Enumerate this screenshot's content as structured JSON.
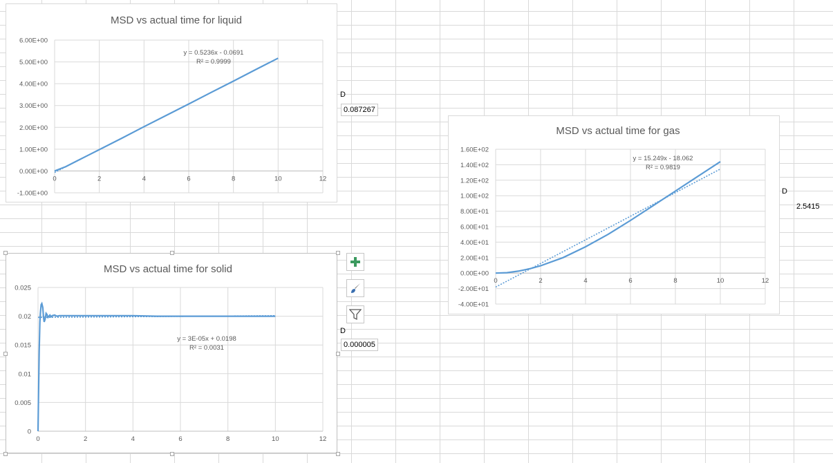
{
  "chart_data": [
    {
      "id": "liquid",
      "type": "line",
      "title": "MSD vs actual time for liquid",
      "xlabel": "",
      "ylabel": "",
      "xlim": [
        0,
        12
      ],
      "ylim": [
        -1,
        6
      ],
      "x_ticks": [
        0,
        2,
        4,
        6,
        8,
        10,
        12
      ],
      "x_tick_labels": [
        "0",
        "2",
        "4",
        "6",
        "8",
        "10",
        "12"
      ],
      "y_ticks": [
        -1,
        0,
        1,
        2,
        3,
        4,
        5,
        6
      ],
      "y_tick_labels": [
        "-1.00E+00",
        "0.00E+00",
        "1.00E+00",
        "2.00E+00",
        "3.00E+00",
        "4.00E+00",
        "5.00E+00",
        "6.00E+00"
      ],
      "grid": true,
      "series": [
        {
          "kind": "data",
          "color": "#5b9bd5",
          "x": [
            0,
            0.5,
            1,
            2,
            3,
            4,
            5,
            6,
            7,
            8,
            9,
            10
          ],
          "y": [
            0.0,
            0.2,
            0.46,
            0.98,
            1.5,
            2.03,
            2.55,
            3.07,
            3.6,
            4.12,
            4.65,
            5.17
          ]
        },
        {
          "kind": "trendline",
          "color": "#5b9bd5",
          "x": [
            0,
            10
          ],
          "y": [
            -0.0691,
            5.1669
          ]
        }
      ],
      "annotation": {
        "line1": "y = 0.5236x - 0.0691",
        "line2": "R² = 0.9999"
      }
    },
    {
      "id": "gas",
      "type": "line",
      "title": "MSD vs actual time for gas",
      "xlabel": "",
      "ylabel": "",
      "xlim": [
        0,
        12
      ],
      "ylim": [
        -40,
        160
      ],
      "x_ticks": [
        0,
        2,
        4,
        6,
        8,
        10,
        12
      ],
      "x_tick_labels": [
        "0",
        "2",
        "4",
        "6",
        "8",
        "10",
        "12"
      ],
      "y_ticks": [
        -40,
        -20,
        0,
        20,
        40,
        60,
        80,
        100,
        120,
        140,
        160
      ],
      "y_tick_labels": [
        "-4.00E+01",
        "-2.00E+01",
        "0.00E+00",
        "2.00E+01",
        "4.00E+01",
        "6.00E+01",
        "8.00E+01",
        "1.00E+02",
        "1.20E+02",
        "1.40E+02",
        "1.60E+02"
      ],
      "grid": true,
      "series": [
        {
          "kind": "data",
          "color": "#5b9bd5",
          "x": [
            0,
            0.5,
            1,
            1.5,
            2,
            3,
            4,
            5,
            6,
            7,
            8,
            9,
            10
          ],
          "y": [
            0,
            0.5,
            2.5,
            5.5,
            9.5,
            20,
            34,
            50,
            68,
            87,
            106,
            125,
            144
          ]
        },
        {
          "kind": "trendline",
          "color": "#5b9bd5",
          "x": [
            0,
            10
          ],
          "y": [
            -18.062,
            134.428
          ]
        }
      ],
      "annotation": {
        "line1": "y = 15.249x - 18.062",
        "line2": "R² = 0.9819"
      }
    },
    {
      "id": "solid",
      "type": "line",
      "title": "MSD vs actual time for solid",
      "xlabel": "",
      "ylabel": "",
      "xlim": [
        0,
        12
      ],
      "ylim": [
        0,
        0.025
      ],
      "x_ticks": [
        0,
        2,
        4,
        6,
        8,
        10,
        12
      ],
      "x_tick_labels": [
        "0",
        "2",
        "4",
        "6",
        "8",
        "10",
        "12"
      ],
      "y_ticks": [
        0,
        0.005,
        0.01,
        0.015,
        0.02,
        0.025
      ],
      "y_tick_labels": [
        "0",
        "0.005",
        "0.01",
        "0.015",
        "0.02",
        "0.025"
      ],
      "grid": true,
      "series": [
        {
          "kind": "data",
          "color": "#5b9bd5",
          "x": [
            0,
            0.02,
            0.05,
            0.08,
            0.1,
            0.13,
            0.16,
            0.2,
            0.23,
            0.26,
            0.3,
            0.34,
            0.38,
            0.42,
            0.46,
            0.5,
            0.55,
            0.6,
            0.7,
            0.8,
            0.9,
            1.0,
            1.5,
            2,
            3,
            4,
            5,
            6,
            7,
            8,
            9,
            10
          ],
          "y": [
            0,
            0.006,
            0.014,
            0.019,
            0.0205,
            0.022,
            0.0222,
            0.0215,
            0.0199,
            0.019,
            0.0195,
            0.0205,
            0.0203,
            0.0198,
            0.02,
            0.0202,
            0.0199,
            0.0201,
            0.0202,
            0.02,
            0.0201,
            0.0201,
            0.0201,
            0.0201,
            0.0201,
            0.0201,
            0.02,
            0.02,
            0.02,
            0.02,
            0.02,
            0.02
          ]
        },
        {
          "kind": "trendline",
          "color": "#5b9bd5",
          "x": [
            0,
            10
          ],
          "y": [
            0.0198,
            0.0201
          ]
        }
      ],
      "annotation": {
        "line1": "y = 3E-05x + 0.0198",
        "line2": "R² = 0.0031"
      }
    }
  ],
  "cells": {
    "liquid_d_label": "D",
    "liquid_d_value": "0.087267",
    "gas_d_label": "D",
    "gas_d_value": "2.5415",
    "solid_d_label": "D",
    "solid_d_value": "0.000005"
  },
  "chart_tools": {
    "icons": [
      "plus-icon",
      "brush-icon",
      "filter-icon"
    ],
    "colors": {
      "plus": "#3c9a5f",
      "brush": "#3a6fb0",
      "filter": "#595959"
    }
  },
  "colors": {
    "series": "#5b9bd5",
    "grid": "#d9d9d9",
    "axis_text": "#595959",
    "title": "#595959"
  }
}
